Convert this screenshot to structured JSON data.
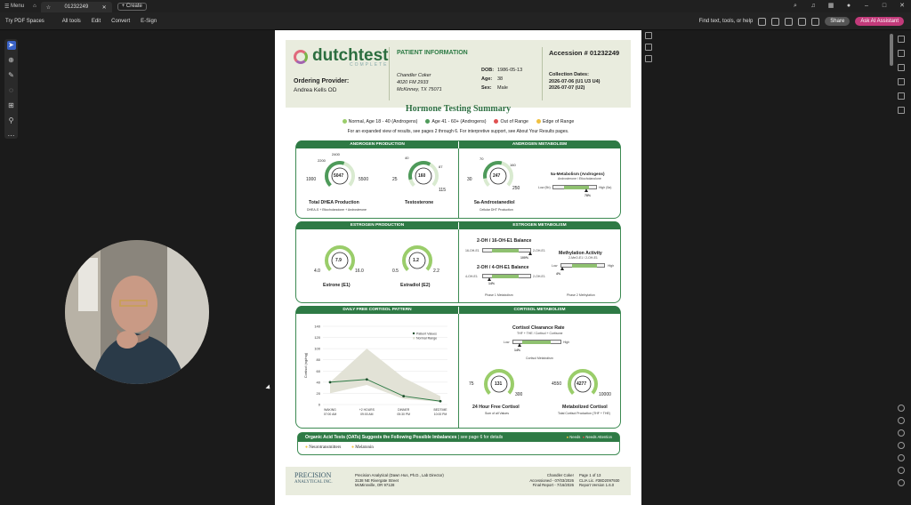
{
  "titlebar": {
    "menu": "Menu",
    "tab_title": "01232249",
    "create": "Create"
  },
  "toolbar": {
    "items": [
      "Try PDF Spaces",
      "All tools",
      "Edit",
      "Convert",
      "E-Sign"
    ],
    "find": "Find text, tools, or help",
    "share": "Share",
    "ask_ai": "Ask AI Assistant"
  },
  "report": {
    "brand": "dutchtest",
    "brand_sub": "COMPLETE",
    "ordering_provider_label": "Ordering Provider:",
    "ordering_provider": "Andrea Kells OD",
    "patient_info_title": "PATIENT INFORMATION",
    "patient_name": "Chandler Coker",
    "patient_address1": "4020 FM 2933",
    "patient_address2": "McKinney, TX 75071",
    "dob_label": "DOB:",
    "dob": "1986-05-13",
    "age_label": "Age:",
    "age": "38",
    "sex_label": "Sex:",
    "sex": "Male",
    "accession": "Accession # 01232249",
    "collection_label": "Collection Dates:",
    "collection1": "2026-07-06 (U1 U3 U4)",
    "collection2": "2026-07-07 (U2)",
    "summary_title": "Hormone Testing Summary",
    "legend": [
      "Normal, Age 18 - 40 (Androgens)",
      "Age 41 - 60+ (Androgens)",
      "Out of Range",
      "Edge of Range"
    ],
    "legend_colors": [
      "#9acd6a",
      "#4e9a5a",
      "#e05050",
      "#f0c040"
    ],
    "subline": "For an expanded view of results, see pages 2 through 6. For interpretive support, see About Your Results pages.",
    "panels": {
      "androgen_production": "ANDROGEN PRODUCTION",
      "androgen_metabolism": "ANDROGEN METABOLISM",
      "estrogen_production": "ESTROGEN PRODUCTION",
      "estrogen_metabolism": "ESTROGEN METABOLISM",
      "cortisol_pattern": "DAILY FREE CORTISOL PATTERN",
      "cortisol_metabolism": "CORTISOL METABOLISM"
    },
    "gauges": {
      "dhea": {
        "value": "5047",
        "min": "1000",
        "max": "5500",
        "t1": "2200",
        "t2": "2400",
        "label": "Total DHEA Production",
        "sub": "DHEA-S + Etiocholanolone + Androsterone"
      },
      "testo": {
        "value": "160",
        "min": "25",
        "max": "115",
        "t1": "40",
        "t2": "87",
        "label": "Testosterone"
      },
      "andro": {
        "value": "247",
        "min": "30",
        "max": "250",
        "t1": "70",
        "t2": "160",
        "label": "5a-Androstanediol",
        "sub": "Cellular DHT Production"
      },
      "estrone": {
        "value": "7.9",
        "min": "4.0",
        "max": "16.0",
        "label": "Estrone (E1)"
      },
      "estradiol": {
        "value": "1.2",
        "min": "0.5",
        "max": "2.2",
        "label": "Estradiol (E2)"
      },
      "free_cortisol": {
        "value": "131",
        "min": "75",
        "max": "300",
        "label": "24 Hour Free Cortisol",
        "sub": "Sum of all Values"
      },
      "metab_cortisol": {
        "value": "4277",
        "min": "4550",
        "max": "10000",
        "label": "Metabolized Cortisol",
        "sub": "Total Cortisol Production (THF + THE)"
      }
    },
    "bars": {
      "five_a": {
        "title": "5a-Metabolism (Androgens)",
        "sub": "Androsterone / Etiocholanolone",
        "low": "Low (5b)",
        "high": "High (5a)",
        "pct": "78%",
        "value": 0.78
      },
      "oh16": {
        "title": "2-OH / 16-OH-E1 Balance",
        "low": "16-OH-E1",
        "high": "2-OH-E1",
        "pct": "100%",
        "value": 1.0
      },
      "oh4": {
        "title": "2-OH / 4-OH-E1 Balance",
        "low": "4-OH-E1",
        "high": "2-OH-E1",
        "pct": "14%",
        "value": 0.14
      },
      "methyl": {
        "title": "Methylation Activity",
        "sub": "2-MeO-E1 / 2-OH-E1",
        "low": "Low",
        "high": "High",
        "pct": "4%",
        "value": 0.04
      },
      "clearance": {
        "title": "Cortisol Clearance Rate",
        "sub": "THF + THE / Cortisol + Cortisone",
        "low": "Low",
        "high": "High",
        "pct": "14%",
        "value": 0.14,
        "note": "Cortisol Metabolism"
      }
    },
    "phase1": "Phase 1 Metabolism",
    "phase2": "Phase 2 Methylation",
    "cortisol_chart_legend": [
      "Patient Values",
      "Normal Range"
    ],
    "oat_title": "Organic Acid Tests (OATs) Suggests the Following Possible Imbalances",
    "oat_sub": " | see page 6 for details",
    "oat_items": [
      "Neurotransmitters",
      "Melatonin"
    ],
    "oat_legend": [
      "Needs",
      "Needs Attention"
    ],
    "footer": {
      "lab_name": "PRECISION",
      "lab_name2": "ANALYTICAL INC.",
      "lab_line1": "Precision Analytical (Dawn Hus, Ph.D., Lab Director)",
      "lab_line2": "3138 NE Rivergate Street",
      "lab_line3": "McMinnville, OR 97128",
      "p1": "Chandler Coker",
      "p2": "Accessioned - 07/03/2026",
      "p3": "Final Report - 7/16/2026",
      "pg1": "Page 1 of 13",
      "pg2": "CLIA Lic. #38D2097930",
      "pg3": "Report Version 1.6.0"
    }
  },
  "chart_data": {
    "type": "line",
    "title": "DAILY FREE CORTISOL PATTERN",
    "ylabel": "Cortisol (ng/mg)",
    "categories": [
      "WAKING 07:00 AM",
      "+2 HOURS 09:00 AM",
      "DINNER 05:30 PM",
      "BEDTIME 10:00 PM"
    ],
    "ylim": [
      0,
      140
    ],
    "yticks": [
      0,
      20,
      40,
      60,
      80,
      100,
      120,
      140
    ],
    "series": [
      {
        "name": "Patient Values",
        "values": [
          40,
          45,
          15,
          6
        ]
      },
      {
        "name": "Normal Range",
        "low": [
          20,
          35,
          10,
          5
        ],
        "high": [
          40,
          100,
          48,
          15
        ]
      }
    ]
  }
}
